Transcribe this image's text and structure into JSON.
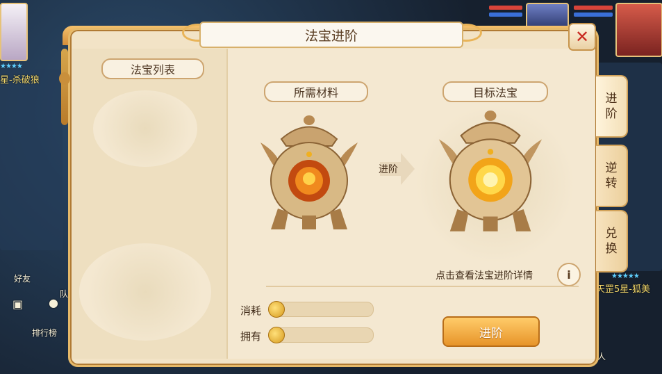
{
  "window": {
    "title": "法宝进阶",
    "close_icon": "close-icon"
  },
  "left_panel": {
    "heading": "法宝列表"
  },
  "materials": {
    "heading": "所需材料"
  },
  "target": {
    "heading": "目标法宝"
  },
  "arrow_label": "进阶",
  "tabs": [
    {
      "label": "进\n阶",
      "active": true
    },
    {
      "label": "逆\n转",
      "active": false
    },
    {
      "label": "兑\n换",
      "active": false
    }
  ],
  "info": {
    "text": "点击查看法宝进阶详情",
    "icon": "info-icon"
  },
  "resources": [
    {
      "label": "消耗",
      "icon": "coin-icon",
      "value": ""
    },
    {
      "label": "拥有",
      "icon": "coin-icon",
      "value": ""
    }
  ],
  "advance_button": "进阶",
  "background_hud": {
    "left_name": "星-杀破狼",
    "right_name": "天罡5星-狐美",
    "friend": "好友",
    "ranking": "排行榜",
    "team": "队",
    "bottom_right": "人"
  },
  "colors": {
    "accent": "#e79429",
    "title_text": "#5a3d22",
    "close": "#c8281f"
  }
}
